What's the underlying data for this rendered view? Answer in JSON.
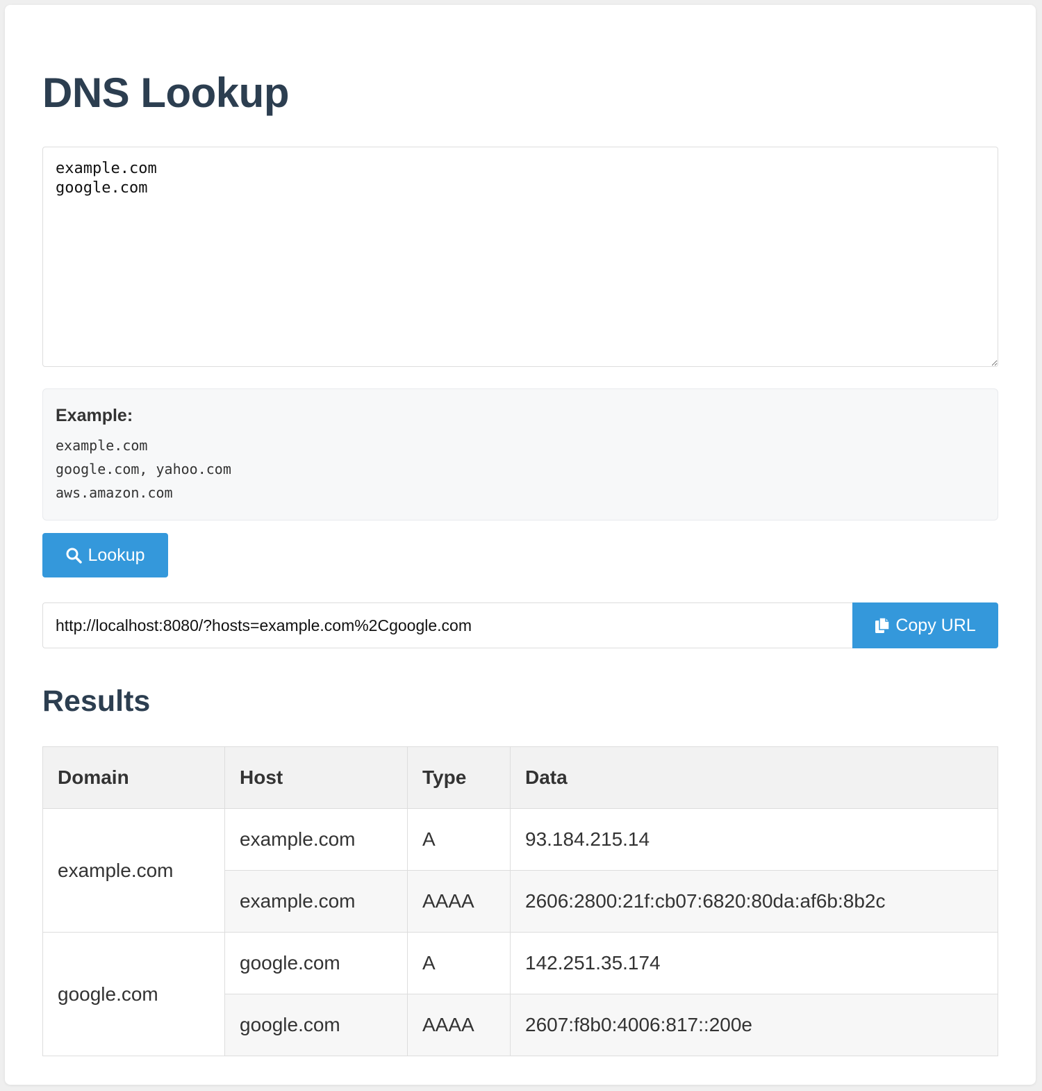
{
  "page": {
    "title": "DNS Lookup"
  },
  "hosts_input": {
    "value": "example.com\ngoogle.com"
  },
  "example": {
    "heading": "Example:",
    "lines": [
      "example.com",
      "google.com, yahoo.com",
      "aws.amazon.com"
    ]
  },
  "lookup_button": {
    "label": "Lookup",
    "icon": "search-icon"
  },
  "share": {
    "url": "http://localhost:8080/?hosts=example.com%2Cgoogle.com",
    "copy_label": "Copy URL",
    "copy_icon": "copy-icon"
  },
  "results": {
    "title": "Results",
    "columns": [
      "Domain",
      "Host",
      "Type",
      "Data"
    ],
    "groups": [
      {
        "domain": "example.com",
        "records": [
          {
            "host": "example.com",
            "type": "A",
            "data": "93.184.215.14"
          },
          {
            "host": "example.com",
            "type": "AAAA",
            "data": "2606:2800:21f:cb07:6820:80da:af6b:8b2c"
          }
        ]
      },
      {
        "domain": "google.com",
        "records": [
          {
            "host": "google.com",
            "type": "A",
            "data": "142.251.35.174"
          },
          {
            "host": "google.com",
            "type": "AAAA",
            "data": "2607:f8b0:4006:817::200e"
          }
        ]
      }
    ]
  },
  "colors": {
    "accent": "#3498db",
    "heading": "#2c3e50",
    "text": "#333333",
    "border": "#dddddd",
    "header_bg": "#f2f2f2",
    "alt_row_bg": "#f7f7f7"
  }
}
